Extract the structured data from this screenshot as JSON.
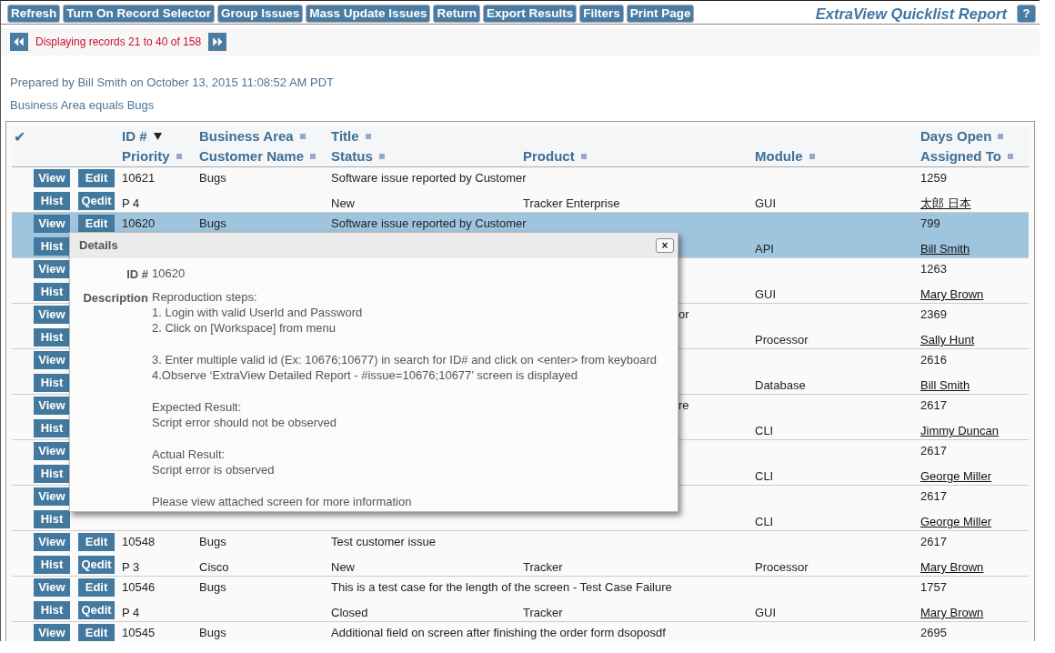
{
  "toolbar": {
    "buttons": [
      "Refresh",
      "Turn On Record Selector",
      "Group Issues",
      "Mass Update Issues",
      "Return",
      "Export Results",
      "Filters",
      "Print Page"
    ],
    "title": "ExtraView Quicklist Report",
    "help": "?"
  },
  "pager": {
    "text": "Displaying records 21 to 40 of 158"
  },
  "prepared": "Prepared by Bill Smith on October 13, 2015 11:08:52 AM PDT",
  "filter": "Business Area equals Bugs",
  "table": {
    "select_mark": "✔",
    "columns": [
      {
        "top": {
          "label": "ID #",
          "sorted": true
        },
        "bottom": {
          "label": "Priority",
          "sorted": false
        }
      },
      {
        "top": {
          "label": "Business Area",
          "sorted": false
        },
        "bottom": {
          "label": "Customer Name",
          "sorted": false
        }
      },
      {
        "top": {
          "label": "Title",
          "sorted": false
        },
        "bottom": {
          "label": "Status",
          "sorted": false
        }
      },
      {
        "bottom": {
          "label": "Product",
          "sorted": false
        }
      },
      {
        "bottom": {
          "label": "Module",
          "sorted": false
        }
      },
      {
        "top": {
          "label": "Days Open",
          "sorted": false
        },
        "bottom": {
          "label": "Assigned To",
          "sorted": false
        }
      }
    ],
    "rows": [
      {
        "selected": false,
        "top_buttons": [
          "View",
          "Edit"
        ],
        "bottom_buttons": [
          "Hist",
          "Qedit"
        ],
        "id": "10621",
        "business_area": "Bugs",
        "title": "Software issue reported by Customer",
        "days_open": "1259",
        "priority": "P 4",
        "status": "New",
        "product": "Tracker Enterprise",
        "module": "GUI",
        "assigned_to": "太郎 日本"
      },
      {
        "selected": true,
        "top_buttons": [
          "View",
          "Edit"
        ],
        "bottom_buttons": [
          "Hist"
        ],
        "id": "10620",
        "business_area": "Bugs",
        "title": "Software issue reported by Customer",
        "days_open": "799",
        "module": "API",
        "assigned_to": "Bill Smith"
      },
      {
        "selected": false,
        "top_buttons": [
          "View"
        ],
        "bottom_buttons": [
          "Hist"
        ],
        "days_open": "1263",
        "module": "GUI",
        "assigned_to": "Mary Brown"
      },
      {
        "selected": false,
        "top_buttons": [
          "View"
        ],
        "bottom_buttons": [
          "Hist"
        ],
        "title_tail": "or",
        "days_open": "2369",
        "module": "Processor",
        "assigned_to": "Sally Hunt"
      },
      {
        "selected": false,
        "top_buttons": [
          "View"
        ],
        "bottom_buttons": [
          "Hist"
        ],
        "days_open": "2616",
        "module": "Database",
        "assigned_to": "Bill Smith"
      },
      {
        "selected": false,
        "top_buttons": [
          "View"
        ],
        "bottom_buttons": [
          "Hist"
        ],
        "title_tail": "re",
        "days_open": "2617",
        "module": "CLI",
        "assigned_to": "Jimmy Duncan"
      },
      {
        "selected": false,
        "top_buttons": [
          "View"
        ],
        "bottom_buttons": [
          "Hist"
        ],
        "days_open": "2617",
        "module": "CLI",
        "assigned_to": "George Miller"
      },
      {
        "selected": false,
        "top_buttons": [
          "View"
        ],
        "bottom_buttons": [
          "Hist"
        ],
        "days_open": "2617",
        "module": "CLI",
        "assigned_to": "George Miller"
      },
      {
        "selected": false,
        "top_buttons": [
          "View",
          "Edit"
        ],
        "bottom_buttons": [
          "Hist",
          "Qedit"
        ],
        "id": "10548",
        "business_area": "Bugs",
        "title": "Test customer issue",
        "days_open": "2617",
        "priority": "P 3",
        "customer_name": "Cisco",
        "status": "New",
        "product": "Tracker",
        "module": "Processor",
        "assigned_to": "Mary Brown"
      },
      {
        "selected": false,
        "top_buttons": [
          "View",
          "Edit"
        ],
        "bottom_buttons": [
          "Hist",
          "Qedit"
        ],
        "id": "10546",
        "business_area": "Bugs",
        "title": "This is a test case for the length of the screen - Test Case Failure",
        "days_open": "1757",
        "priority": "P 4",
        "status": "Closed",
        "product": "Tracker",
        "module": "GUI",
        "assigned_to": "Mary Brown"
      },
      {
        "selected": false,
        "top_buttons": [
          "View",
          "Edit"
        ],
        "id": "10545",
        "business_area": "Bugs",
        "title": "Additional field on screen after finishing the order form dsoposdf",
        "days_open": "2695"
      }
    ]
  },
  "details": {
    "title": "Details",
    "close": "×",
    "fields": [
      {
        "label": "ID #",
        "paragraphs": [
          [
            "10620"
          ]
        ]
      },
      {
        "label": "Description",
        "paragraphs": [
          [
            "Reproduction steps:",
            "1. Login with valid UserId and Password",
            "2. Click on [Workspace] from menu"
          ],
          [
            "3. Enter multiple valid id (Ex: 10676;10677) in search for ID# and click on <enter> from keyboard",
            "4.Observe ‘ExtraView Detailed Report - #issue=10676;10677’ screen is displayed"
          ],
          [
            "Expected Result:",
            "Script error should not be observed"
          ],
          [
            "Actual Result:",
            "Script error is observed"
          ],
          [
            "Please view attached screen for more information"
          ]
        ]
      }
    ]
  }
}
